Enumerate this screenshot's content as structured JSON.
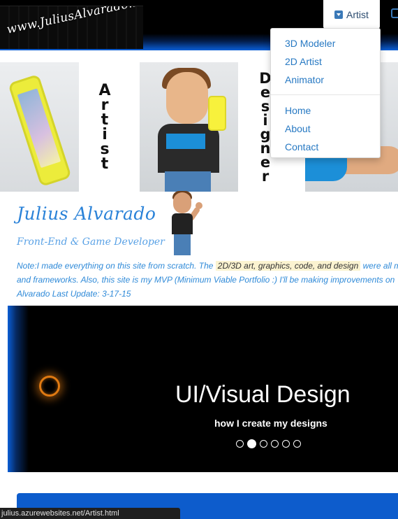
{
  "logo": {
    "text": "www.JuliusAlvarado.info"
  },
  "nav": {
    "artist_label": "Artist"
  },
  "dropdown": {
    "group1": [
      "3D Modeler",
      "2D Artist",
      "Animator"
    ],
    "group2": [
      "Home",
      "About",
      "Contact"
    ]
  },
  "banner": {
    "word_artist": [
      "A",
      "r",
      "t",
      "i",
      "s",
      "t"
    ],
    "word_designer": [
      "D",
      "e",
      "s",
      "i",
      "g",
      "n",
      "e",
      "r"
    ]
  },
  "profile": {
    "name": "Julius Alvarado",
    "subtitle": "Front-End & Game Developer"
  },
  "note": {
    "line1_pre": "Note:I made everything on this site from scratch. The ",
    "line1_highlight": "2D/3D art, graphics, code, and design",
    "line1_post": " were all m",
    "line2": "and frameworks. Also, this site is my MVP (Minimum Viable Portfolio :) I'll be making improvements on",
    "line3": "Alvarado Last Update: 3-17-15"
  },
  "carousel": {
    "title": "UI/Visual Design",
    "caption": "how I create my designs",
    "slide_count": 6,
    "active_index": 1
  },
  "status_bar": {
    "url": "julius.azurewebsites.net/Artist.html"
  },
  "colors": {
    "accent": "#2a82d8",
    "brand_blue": "#0d5ccc",
    "glow_orange": "#e07a12"
  }
}
